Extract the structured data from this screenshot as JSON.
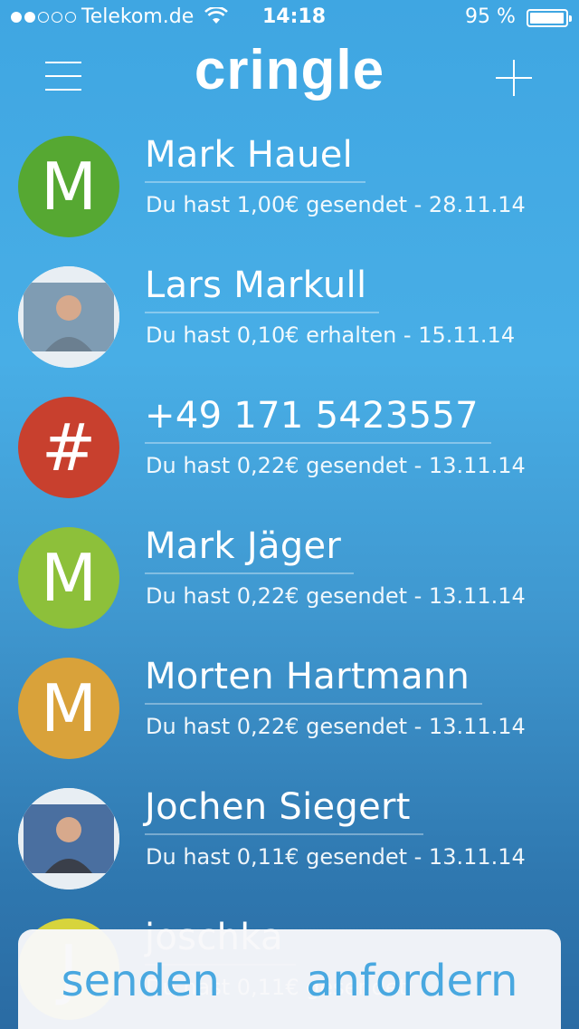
{
  "status_bar": {
    "carrier": "Telekom.de",
    "time": "14:18",
    "battery": "95 %",
    "signal_bars_filled": 2,
    "signal_bars_total": 5
  },
  "header": {
    "logo": "cringle",
    "menu_icon": "hamburger-menu-icon",
    "add_icon": "plus-icon"
  },
  "contacts": [
    {
      "name": "Mark Hauel",
      "detail": "Du hast 1,00€ gesendet - 28.11.14",
      "avatar_type": "initial",
      "initial": "M",
      "color": "#56a832"
    },
    {
      "name": "Lars Markull",
      "detail": "Du hast 0,10€ erhalten - 15.11.14",
      "avatar_type": "photo",
      "color": "#6b7f90"
    },
    {
      "name": "+49 171 5423557",
      "detail": "Du hast 0,22€ gesendet - 13.11.14",
      "avatar_type": "initial",
      "initial": "#",
      "color": "#c8402e"
    },
    {
      "name": "Mark Jäger",
      "detail": "Du hast 0,22€ gesendet - 13.11.14",
      "avatar_type": "initial",
      "initial": "M",
      "color": "#8dc03a"
    },
    {
      "name": "Morten Hartmann",
      "detail": "Du hast 0,22€ gesendet - 13.11.14",
      "avatar_type": "initial",
      "initial": "M",
      "color": "#d9a23a"
    },
    {
      "name": "Jochen Siegert",
      "detail": "Du hast 0,11€ gesendet - 13.11.14",
      "avatar_type": "photo",
      "color": "#3a3f4a"
    },
    {
      "name": "joschka",
      "detail": "Du hast 0,11€ gesendet",
      "avatar_type": "initial",
      "initial": "J",
      "color": "#d7d43c"
    }
  ],
  "actions": {
    "send": "senden",
    "request": "anfordern"
  }
}
